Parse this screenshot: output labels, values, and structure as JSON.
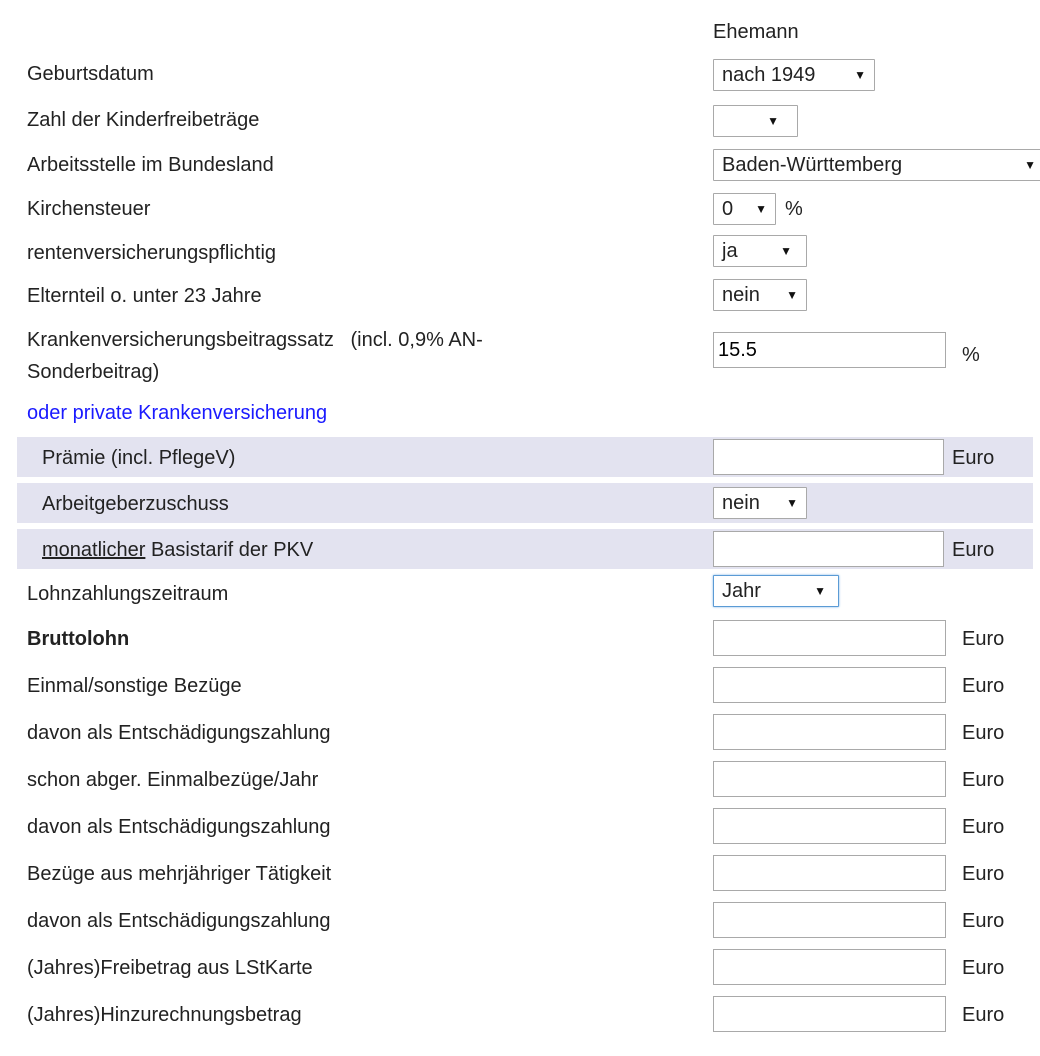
{
  "header": {
    "column_label": "Ehemann"
  },
  "rows": {
    "geburtsdatum": {
      "label": "Geburtsdatum",
      "value": "nach 1949"
    },
    "kinderfreibetraege": {
      "label": "Zahl der Kinderfreibeträge",
      "value": ""
    },
    "bundesland": {
      "label": "Arbeitsstelle im Bundesland",
      "value": "Baden-Württemberg"
    },
    "kirchensteuer": {
      "label": "Kirchensteuer",
      "value": "0",
      "unit": "%"
    },
    "rentenversicherung": {
      "label": "rentenversicherungspflichtig",
      "value": "ja"
    },
    "elternteil": {
      "label": "Elternteil o. unter 23 Jahre",
      "value": "nein"
    },
    "krankenversicherung": {
      "label_line1": "Krankenversicherungsbeitragssatz   (incl. 0,9% AN-",
      "label_line2": "Sonderbeitrag)",
      "value": "15.5",
      "unit": "%"
    },
    "private_kv_link": {
      "label": "oder private Krankenversicherung"
    },
    "praemie": {
      "label": "Prämie (incl. PflegeV)",
      "value": "",
      "unit": "Euro"
    },
    "arbeitgeberzuschuss": {
      "label": "Arbeitgeberzuschuss",
      "value": "nein"
    },
    "basistarif": {
      "label_underlined": "monatlicher",
      "label_rest": " Basistarif der PKV",
      "value": "",
      "unit": "Euro"
    },
    "lohnzahlungszeitraum": {
      "label": "Lohnzahlungszeitraum",
      "value": "Jahr"
    },
    "bruttolohn": {
      "label": "Bruttolohn",
      "value": "",
      "unit": "Euro"
    },
    "einmal_bezuege": {
      "label": "Einmal/sonstige Bezüge",
      "value": "",
      "unit": "Euro"
    },
    "entschaedigung1": {
      "label": "davon als Entschädigungszahlung",
      "value": "",
      "unit": "Euro"
    },
    "abger_einmalbezuege": {
      "label": "schon abger. Einmalbezüge/Jahr",
      "value": "",
      "unit": "Euro"
    },
    "entschaedigung2": {
      "label": "davon als Entschädigungszahlung",
      "value": "",
      "unit": "Euro"
    },
    "mehrjaehrig": {
      "label": "Bezüge aus mehrjähriger Tätigkeit",
      "value": "",
      "unit": "Euro"
    },
    "entschaedigung3": {
      "label": "davon als Entschädigungszahlung",
      "value": "",
      "unit": "Euro"
    },
    "freibetrag": {
      "label": "(Jahres)Freibetrag aus LStKarte",
      "value": "",
      "unit": "Euro"
    },
    "hinzurechnung": {
      "label": "(Jahres)Hinzurechnungsbetrag",
      "value": "",
      "unit": "Euro"
    }
  },
  "icons": {
    "dropdown_arrow": "▼"
  },
  "colors": {
    "band_background": "#e3e3f0",
    "link": "#1a1aff",
    "focus_border": "#5b9bd5"
  }
}
